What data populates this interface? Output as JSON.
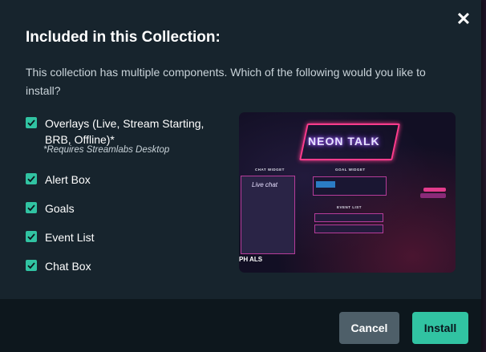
{
  "dialog": {
    "title": "Included in this Collection:",
    "description": "This collection has multiple components. Which of the following would you like to install?",
    "close_icon": "close-icon"
  },
  "components": [
    {
      "label": "Overlays (Live, Stream Starting, BRB, Offline)*",
      "checked": true
    },
    {
      "label": "Alert Box",
      "checked": true
    },
    {
      "label": "Goals",
      "checked": true
    },
    {
      "label": "Event List",
      "checked": true
    },
    {
      "label": "Chat Box",
      "checked": true
    }
  ],
  "note": "*Requires Streamlabs Desktop",
  "preview": {
    "theme_title": "NEON TALK",
    "chat_widget_label": "CHAT WIDGET",
    "chat_title": "Live chat",
    "goal_widget_label": "GOAL WIDGET",
    "event_list_label": "EVENT LIST",
    "brand_mark": "PH ALS"
  },
  "buttons": {
    "cancel": "Cancel",
    "install": "Install"
  },
  "colors": {
    "accent": "#31c3a2",
    "modal_bg": "#17242d",
    "cancel_bg": "#4e5f69"
  }
}
